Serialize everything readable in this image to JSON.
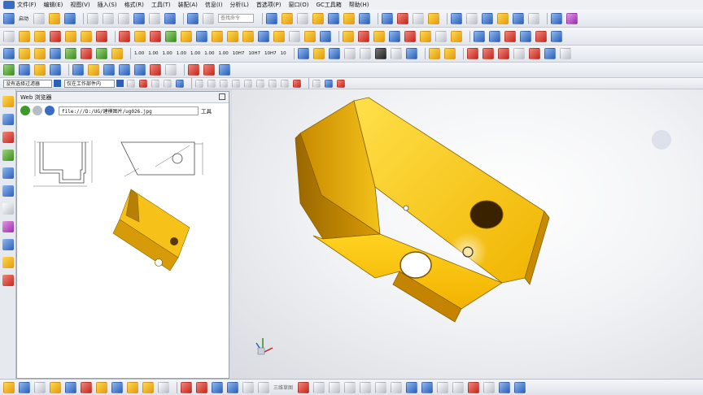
{
  "menubar": {
    "items": [
      "文件(F)",
      "编辑(E)",
      "视图(V)",
      "插入(S)",
      "格式(R)",
      "工具(T)",
      "装配(A)",
      "信息(I)",
      "分析(L)",
      "首选项(P)",
      "窗口(O)",
      "GC工具箱",
      "帮助(H)"
    ]
  },
  "toolbar": {
    "start_label": "启动",
    "search_placeholder": "查找命令",
    "dim_labels": [
      "1.00",
      "1.00",
      "1.00",
      "1.00",
      "1.00",
      "1.00",
      "1.00",
      "10H7",
      "10H7",
      "10H7",
      "10"
    ],
    "filter_label": "没有选择过滤器",
    "assembly_label": "仅在工作部件内"
  },
  "panel": {
    "title": "Web 浏览器",
    "url": "file:///D:/UG/建模图片/ug026.jpg",
    "tools_label": "工具"
  },
  "bottombar": {
    "label": "三维草图"
  },
  "colors": {
    "part_yellow": "#f5b800",
    "viewport_bg": "#eef0f3"
  }
}
